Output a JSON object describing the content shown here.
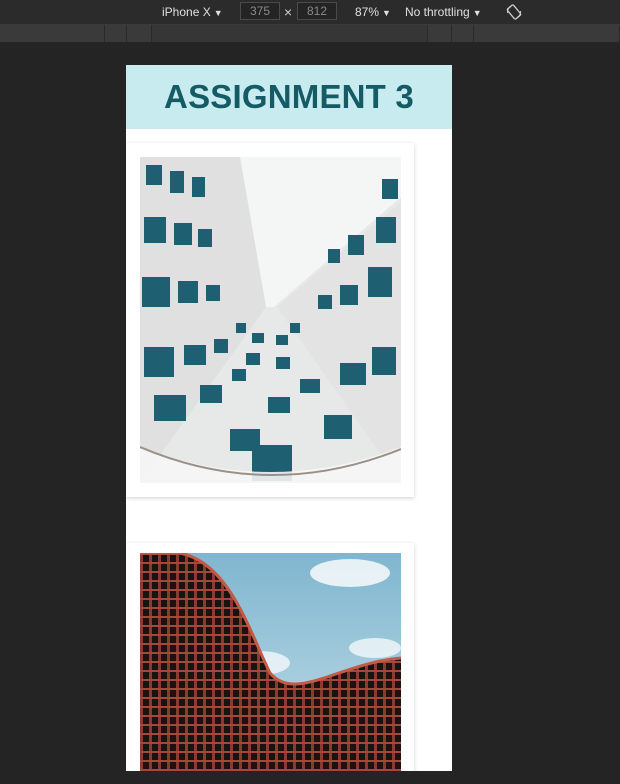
{
  "devtools": {
    "device_label": "iPhone X",
    "width_value": "375",
    "height_value": "812",
    "times_symbol": "×",
    "zoom_label": "87%",
    "throttle_label": "No throttling",
    "icons": {
      "rotate": "rotate-icon",
      "caret": "caret-down-icon"
    }
  },
  "page": {
    "title": "ASSIGNMENT 3",
    "colors": {
      "header_bg": "#c7ebef",
      "title": "#145b66"
    },
    "images": [
      {
        "name": "white-building-upward-photo"
      },
      {
        "name": "wavy-red-building-photo"
      }
    ]
  }
}
